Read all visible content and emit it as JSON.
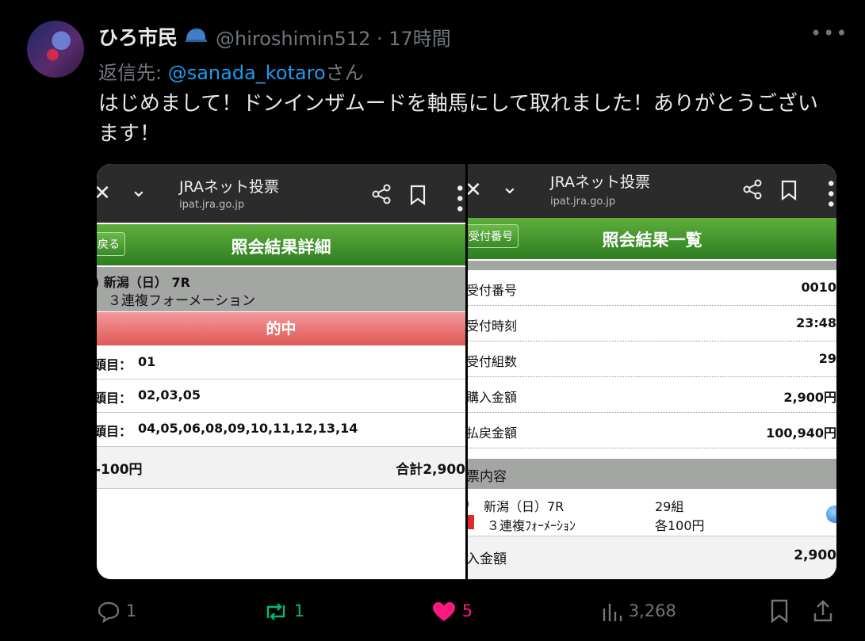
{
  "author": {
    "name": "ひろ市民",
    "handle": "@hiroshimin512",
    "time": "17時間"
  },
  "reply": {
    "prefix": "返信先: ",
    "mention": "@sanada_kotaro",
    "suffix": "さん"
  },
  "tweet_text": "はじめまして！ドンインザムードを軸馬にして取れました！ありがとうございます！",
  "left": {
    "x": "✕",
    "chev": "⌄",
    "title": "JRAネット投票",
    "url": "ipat.jra.go.jp",
    "back": "戻る",
    "header": "照会結果詳細",
    "race_line1": ") 新潟（日） 7R",
    "race_line2": "３連複フォーメーション",
    "hit": "的中",
    "rows": [
      {
        "label": "頭目：",
        "value": "01"
      },
      {
        "label": "頭目：",
        "value": "02,03,05"
      },
      {
        "label": "頭目：",
        "value": "04,05,06,08,09,10,11,12,13,14"
      }
    ],
    "unit": "-100円",
    "total": "合計2,900"
  },
  "right": {
    "x": "✕",
    "chev": "⌄",
    "title": "JRAネット投票",
    "url": "ipat.jra.go.jp",
    "btn": "受付番号",
    "header": "照会結果一覧",
    "rows": [
      {
        "label": "受付番号",
        "value": "0010"
      },
      {
        "label": "受付時刻",
        "value": "23:48"
      },
      {
        "label": "受付組数",
        "value": "29"
      },
      {
        "label": "購入金額",
        "value": "2,900円"
      },
      {
        "label": "払戻金額",
        "value": "100,940円"
      }
    ],
    "section": "票内容",
    "race": "新潟（日）7R",
    "kind": "３連複ﾌｫｰﾒｰｼｮﾝ",
    "kumi": "29組",
    "each": "各100円",
    "purchase_label": "入金額",
    "purchase_value": "2,900"
  },
  "actions": {
    "replies": "1",
    "reposts": "1",
    "likes": "5",
    "views": "3,268"
  },
  "colors": {
    "link": "#1d9bf0",
    "repost": "#00ba7c",
    "like": "#f91880",
    "muted": "#71767b"
  }
}
